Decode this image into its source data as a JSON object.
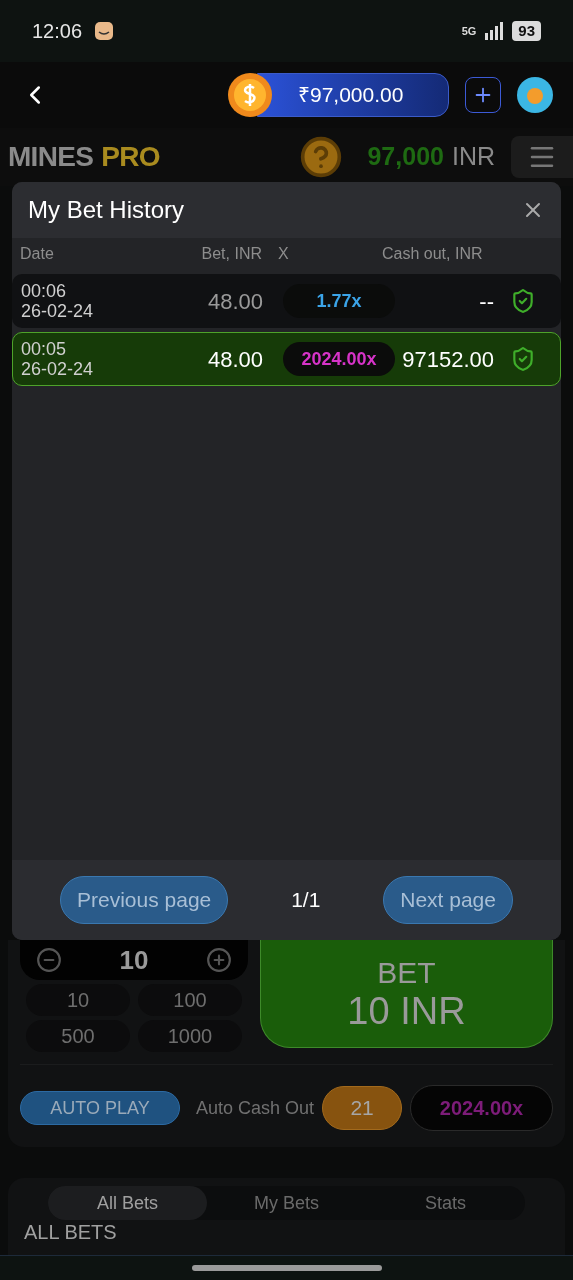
{
  "status_bar": {
    "time": "12:06",
    "network": "5G",
    "battery": "93"
  },
  "header": {
    "balance": "₹97,000.00"
  },
  "game_header": {
    "logo_first": "MINES",
    "logo_second": "PRO",
    "balance_amount": "97,000",
    "balance_currency": "INR"
  },
  "modal": {
    "title": "My Bet History",
    "columns": [
      "Date",
      "Bet, INR",
      "X",
      "Cash out, INR"
    ],
    "rows": [
      {
        "time": "00:06",
        "date": "26-02-24",
        "bet": "48.00",
        "multiplier": "1.77x",
        "color": "#3ba4e8",
        "cash_out": "--",
        "selected": false
      },
      {
        "time": "00:05",
        "date": "26-02-24",
        "bet": "48.00",
        "multiplier": "2024.00x",
        "color": "#d633c8",
        "cash_out": "97152.00",
        "selected": true
      }
    ],
    "previous": "Previous page",
    "page": "1/1",
    "next": "Next page"
  },
  "bet_panel": {
    "amount": "10",
    "chips": [
      "10",
      "100",
      "500",
      "1000"
    ],
    "bet_label": "BET",
    "bet_amount": "10 INR",
    "auto_play": "AUTO PLAY",
    "auto_cash_out_label": "Auto Cash Out",
    "auto_cash_out_value": "21",
    "auto_multiplier": "2024.00x"
  },
  "tabs": [
    {
      "label": "All Bets",
      "selected": true
    },
    {
      "label": "My Bets",
      "selected": false
    },
    {
      "label": "Stats",
      "selected": false
    }
  ],
  "section_title": "ALL BETS"
}
